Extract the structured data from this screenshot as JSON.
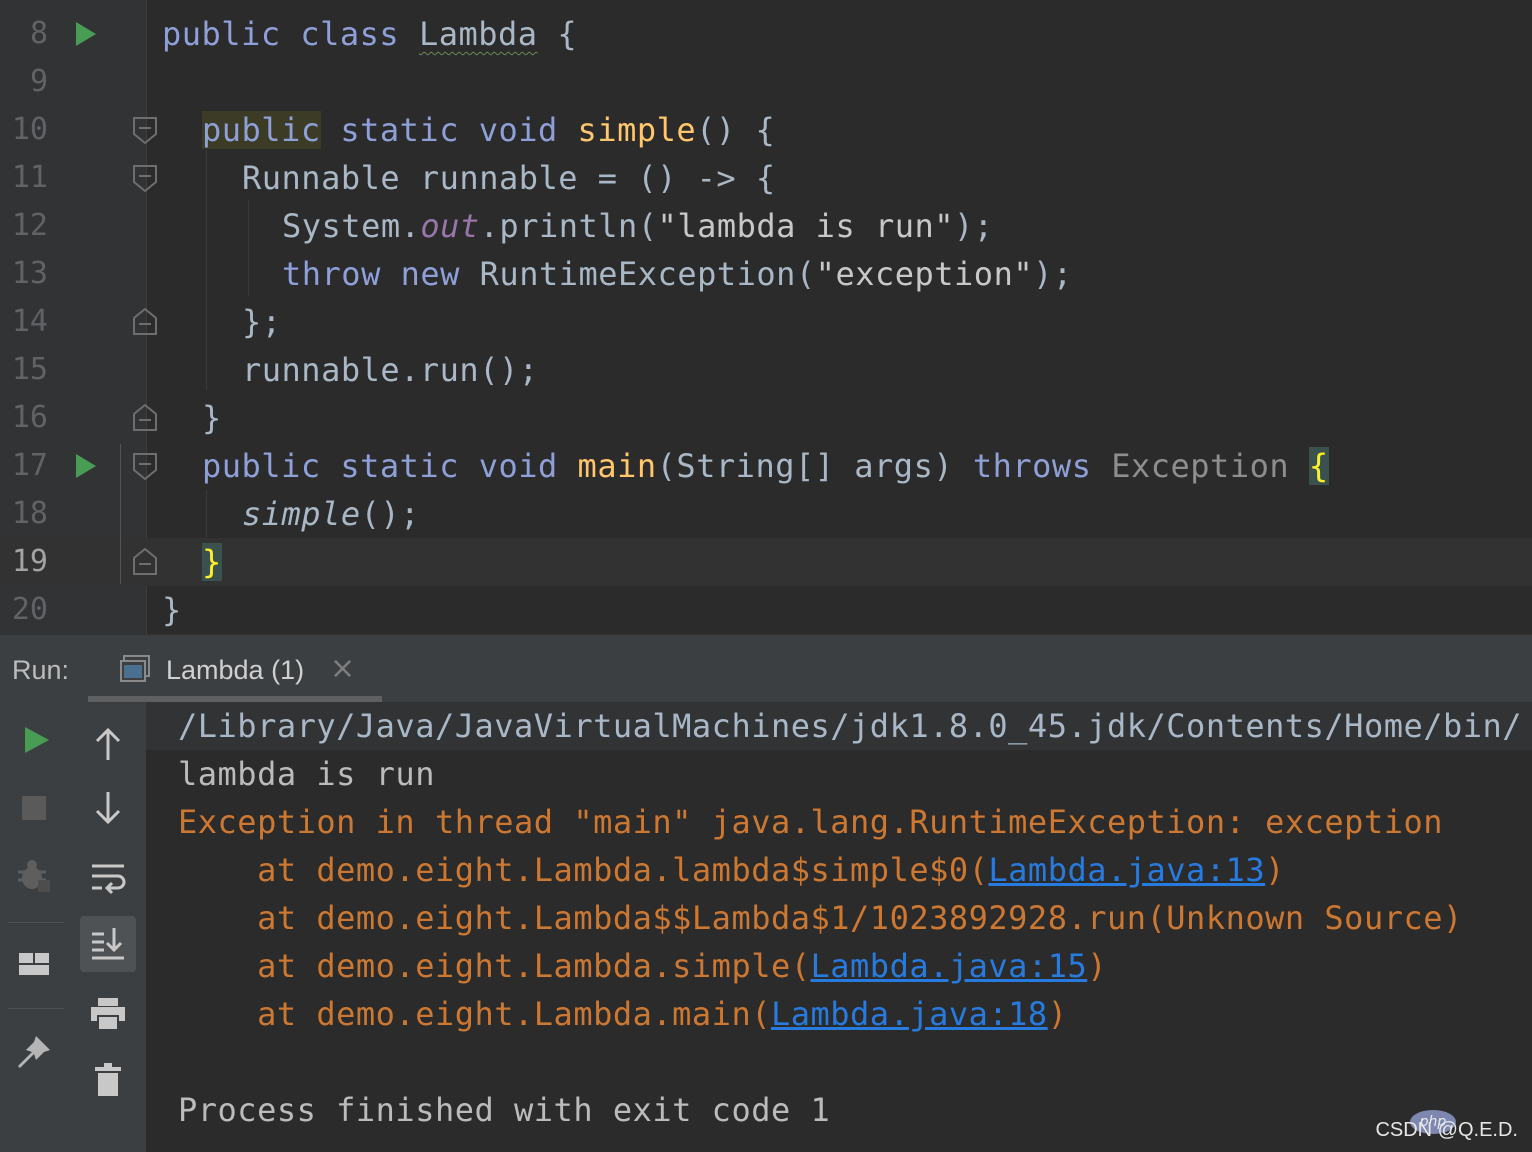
{
  "editor": {
    "lines": [
      {
        "num": "8"
      },
      {
        "num": "9"
      },
      {
        "num": "10"
      },
      {
        "num": "11"
      },
      {
        "num": "12"
      },
      {
        "num": "13"
      },
      {
        "num": "14"
      },
      {
        "num": "15"
      },
      {
        "num": "16"
      },
      {
        "num": "17"
      },
      {
        "num": "18"
      },
      {
        "num": "19"
      },
      {
        "num": "20"
      }
    ],
    "code": {
      "l8_kw": "public class",
      "l8_name": "Lambda",
      "l8_rest": " {",
      "l10_pub": "public",
      "l10_kw": " static void ",
      "l10_fn": "simple",
      "l10_rest": "() {",
      "l11": "Runnable runnable = () -> {",
      "l12_a": "System.",
      "l12_out": "out",
      "l12_b": ".println(",
      "l12_str": "\"lambda is run\"",
      "l12_c": ");",
      "l13_kw": "throw new",
      "l13_a": " RuntimeException(",
      "l13_str": "\"exception\"",
      "l13_b": ");",
      "l14": "};",
      "l15": "runnable.run();",
      "l16": "}",
      "l17_kw": "public static void ",
      "l17_fn": "main",
      "l17_a": "(String[] args) ",
      "l17_throws": "throws",
      "l17_ex": " Exception ",
      "l17_brace": "{",
      "l18_fn": "simple",
      "l18_rest": "();",
      "l19_brace": "}",
      "l20": "}"
    }
  },
  "run_panel": {
    "label": "Run:",
    "tab_title": "Lambda (1)",
    "close_glyph": "×"
  },
  "console": {
    "cmd": "/Library/Java/JavaVirtualMachines/jdk1.8.0_45.jdk/Contents/Home/bin/",
    "out1": "lambda is run",
    "err1": "Exception in thread \"main\" java.lang.RuntimeException: exception",
    "st1_pre": "    at demo.eight.Lambda.lambda$simple$0(",
    "st1_link": "Lambda.java:13",
    "st1_post": ")",
    "st2": "    at demo.eight.Lambda$$Lambda$1/1023892928.run(Unknown Source)",
    "st3_pre": "    at demo.eight.Lambda.simple(",
    "st3_link": "Lambda.java:15",
    "st3_post": ")",
    "st4_pre": "    at demo.eight.Lambda.main(",
    "st4_link": "Lambda.java:18",
    "st4_post": ")",
    "exit": "Process finished with exit code 1"
  },
  "watermark": {
    "logo_text": "php",
    "text": "CSDN @Q.E.D."
  },
  "colors": {
    "keyword": "#8f9fd8",
    "function": "#ffc66d",
    "error": "#cc7832",
    "link": "#287bde",
    "run_green": "#499c54"
  },
  "icons": [
    "run-icon",
    "stop-icon",
    "debug-bug-icon",
    "layout-icon",
    "pin-icon",
    "arrow-up-icon",
    "arrow-down-icon",
    "soft-wrap-icon",
    "scroll-to-end-icon",
    "print-icon",
    "trash-icon",
    "fold-icon",
    "console-tab-icon"
  ]
}
